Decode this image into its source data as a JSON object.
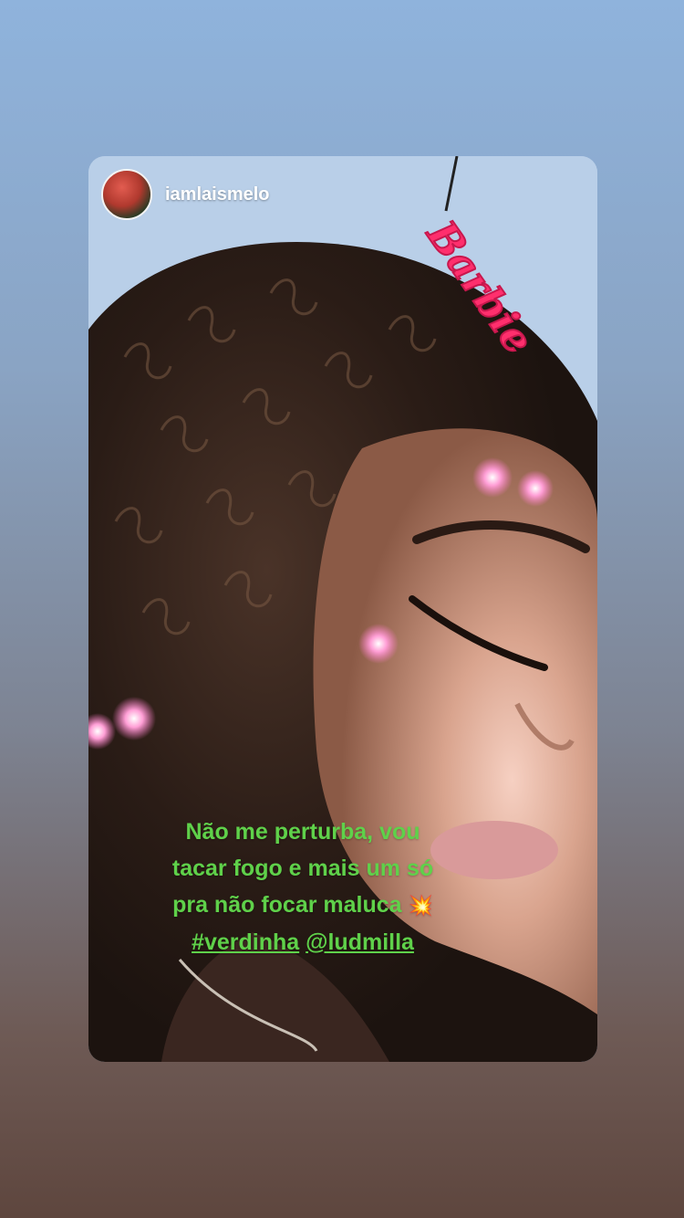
{
  "story": {
    "username": "iamlaismelo",
    "caption_lines": [
      "Não me perturba, vou",
      "tacar fogo e mais um só",
      "pra não focar maluca"
    ],
    "caption_emoji": "💥",
    "hashtag": "#verdinha",
    "mention": "@ludmilla",
    "sticker_text": "Barbie"
  },
  "colors": {
    "caption_green": "#5fd14a",
    "sticker_pink": "#ff2f6d"
  },
  "icons": {
    "avatar": "profile-photo"
  }
}
